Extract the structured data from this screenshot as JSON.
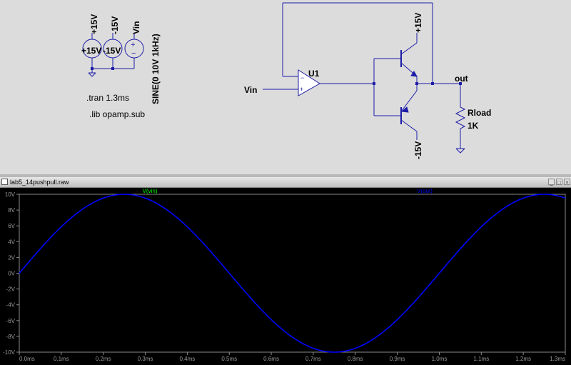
{
  "schematic": {
    "sources": {
      "pos_label": "+15V",
      "neg_label": "-15V",
      "vin_label": "Vin",
      "val1": "+15V",
      "val2": "-15V",
      "val3": "+15V",
      "sine": "SINE(0 10V 1kHz)"
    },
    "directives": {
      "tran": ".tran 1.3ms",
      "lib": ".lib opamp.sub"
    },
    "opamp": {
      "ref": "U1"
    },
    "input_label": "Vin",
    "output_label": "out",
    "top_rail": "+15V",
    "bottom_rail": "-15V",
    "resistor": {
      "name": "Rload",
      "value": "1K"
    }
  },
  "plot": {
    "window_title": "lab5_14pushpull.raw",
    "traces": [
      {
        "name": "V(vin)",
        "color": "#00ff00"
      },
      {
        "name": "V(out)",
        "color": "#0000ff"
      }
    ],
    "trace_color": "#0000ff",
    "y_ticks": [
      "10V",
      "8V",
      "6V",
      "4V",
      "2V",
      "0V",
      "-2V",
      "-4V",
      "-6V",
      "-8V",
      "-10V"
    ],
    "x_ticks": [
      "0.0ms",
      "0.1ms",
      "0.2ms",
      "0.3ms",
      "0.4ms",
      "0.5ms",
      "0.6ms",
      "0.7ms",
      "0.8ms",
      "0.9ms",
      "1.0ms",
      "1.1ms",
      "1.2ms",
      "1.3ms"
    ]
  },
  "chart_data": {
    "type": "line",
    "xlabel": "",
    "ylabel": "",
    "xlim": [
      0,
      1.3
    ],
    "ylim": [
      -10,
      10
    ],
    "grid": false,
    "series": [
      {
        "name": "V(vin)",
        "function": "10*sin(2*pi*1kHz*t)",
        "amplitude": 10,
        "frequency_khz": 1
      },
      {
        "name": "V(out)",
        "function": "10*sin(2*pi*1kHz*t)",
        "amplitude": 10,
        "frequency_khz": 1
      }
    ]
  }
}
